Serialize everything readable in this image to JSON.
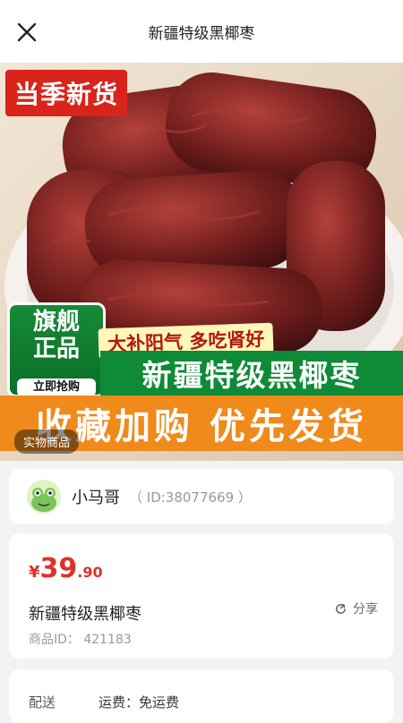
{
  "header": {
    "title": "新疆特级黑椰枣"
  },
  "hero": {
    "tag_new": "当季新货",
    "badge_line1": "旗舰",
    "badge_line2": "正品",
    "badge_pill": "立即抢购",
    "slogan": "大补阳气 多吃肾好",
    "green_banner": "新疆特级黑椰枣",
    "orange_banner": "收藏加购 优先发货",
    "real_tag": "实物商品"
  },
  "seller": {
    "name": "小马哥",
    "id_text": "（ ID:38077669 ）"
  },
  "product": {
    "currency": "¥",
    "price_int": "39",
    "price_dec": ".90",
    "name": "新疆特级黑椰枣",
    "share_label": "分享",
    "id_text": "商品ID： 421183"
  },
  "shipping": {
    "label": "配送",
    "value": "运费：免运费"
  },
  "colors": {
    "accent": "#e0302b",
    "green": "#0f8a36",
    "orange": "#f08a1a"
  }
}
